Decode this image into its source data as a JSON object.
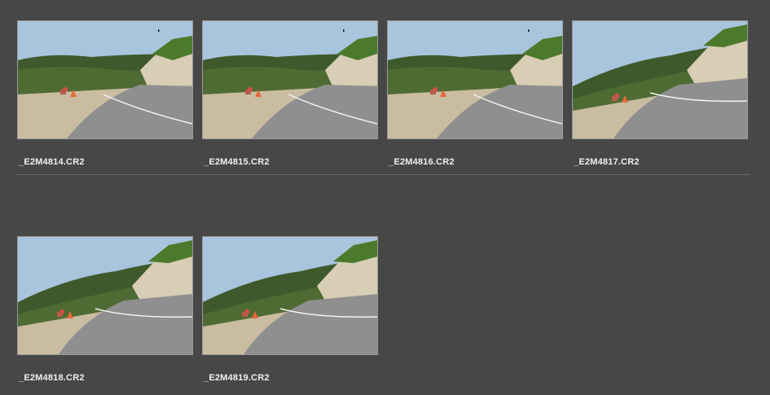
{
  "colors": {
    "background": "#474747",
    "label_text": "#f0f0f0",
    "thumb_border": "#9a9a9a",
    "sky": "#a9c4dd",
    "road": "#8f8f8f",
    "hills": "#3e5a2c"
  },
  "grid": {
    "rows": [
      {
        "items": [
          {
            "filename": "_E2M4814.CR2",
            "scene": "road-curve-wide"
          },
          {
            "filename": "_E2M4815.CR2",
            "scene": "road-curve-wide"
          },
          {
            "filename": "_E2M4816.CR2",
            "scene": "road-curve-wide"
          },
          {
            "filename": "_E2M4817.CR2",
            "scene": "road-curve-tilted"
          }
        ]
      },
      {
        "items": [
          {
            "filename": "_E2M4818.CR2",
            "scene": "road-curve-tilted"
          },
          {
            "filename": "_E2M4819.CR2",
            "scene": "road-curve-tilted"
          }
        ]
      }
    ]
  }
}
